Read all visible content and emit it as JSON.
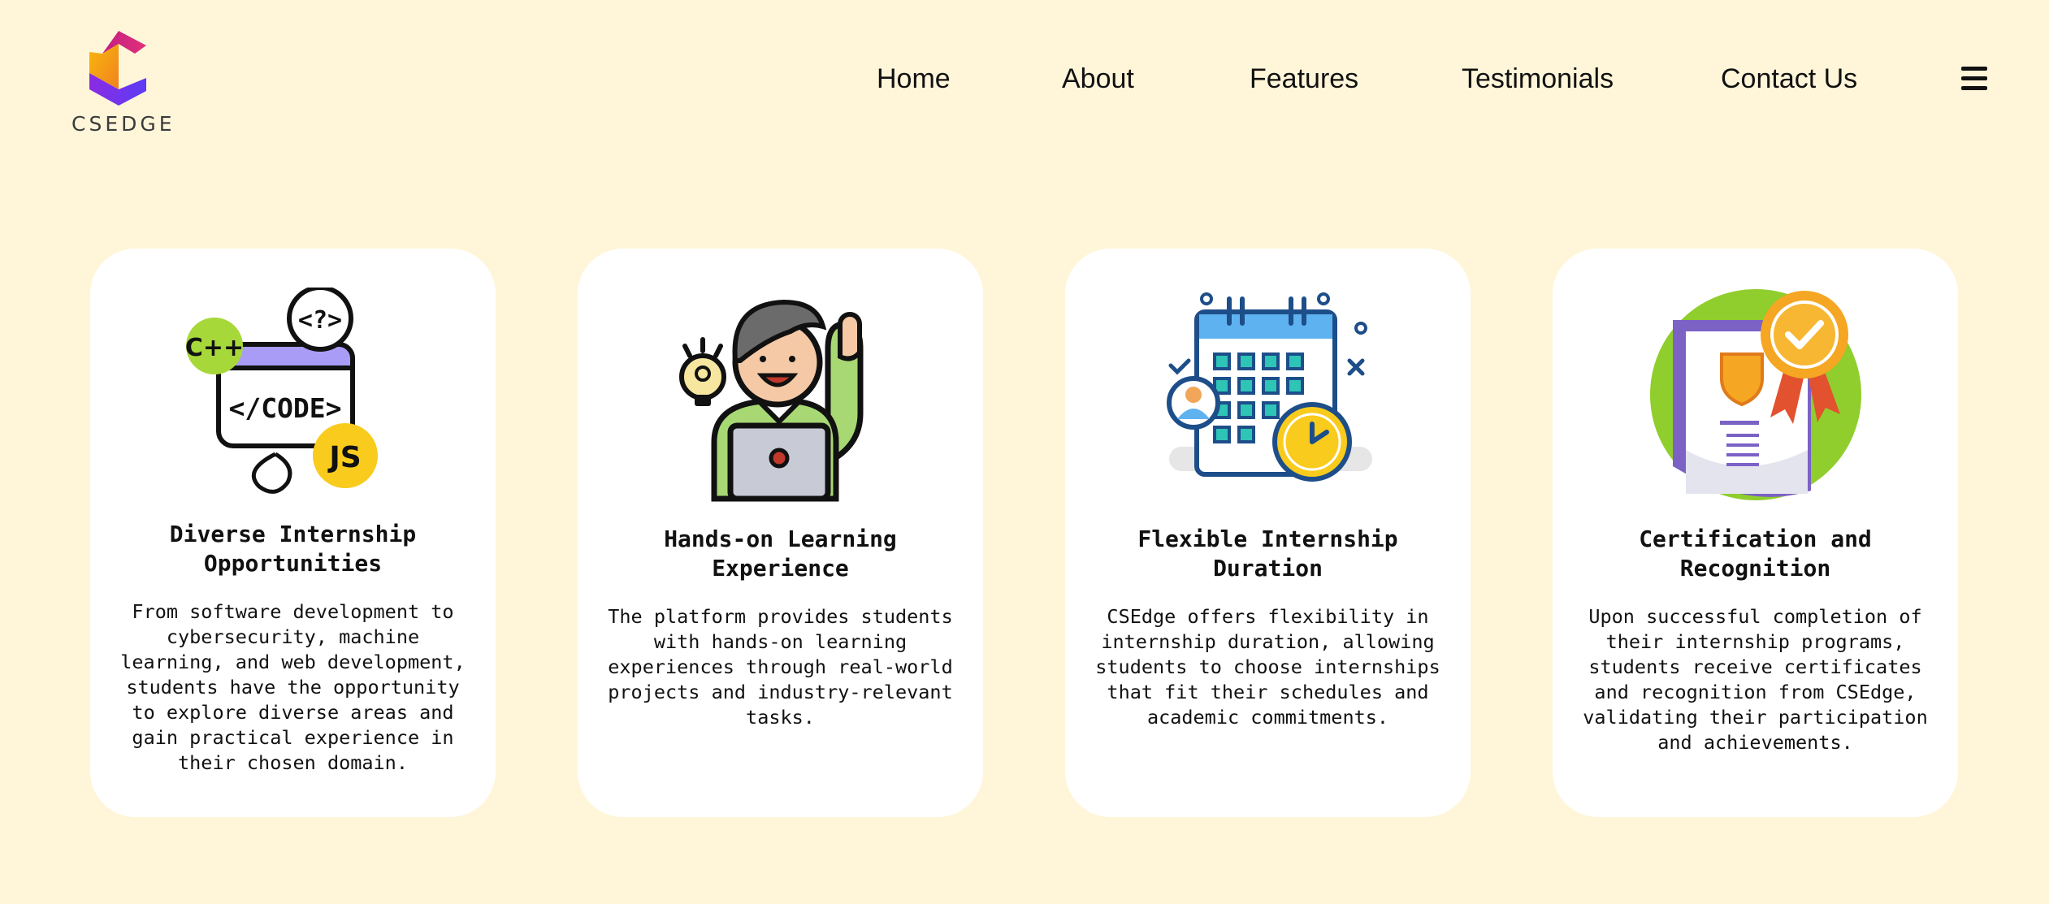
{
  "brand": {
    "name": "CSEDGE",
    "logo_icon": "csedge-c-logo",
    "colors": {
      "magenta": "#d6247a",
      "orange": "#f59e0b",
      "purple": "#7c3aed"
    }
  },
  "nav": {
    "items": [
      {
        "label": "Home"
      },
      {
        "label": "About"
      },
      {
        "label": "Features"
      },
      {
        "label": "Testimonials"
      },
      {
        "label": "Contact Us"
      }
    ],
    "menu_icon": "hamburger-menu-icon"
  },
  "features": [
    {
      "icon": "code-languages-icon",
      "title": "Diverse Internship Opportunities",
      "description": "From software development to cybersecurity, machine learning, and web development, students have the opportunity to explore diverse areas and gain practical experience in their chosen domain."
    },
    {
      "icon": "learner-laptop-icon",
      "title": "Hands-on Learning Experience",
      "description": "The platform provides students with hands-on learning experiences through real-world projects and industry-relevant tasks."
    },
    {
      "icon": "calendar-clock-icon",
      "title": "Flexible Internship Duration",
      "description": "CSEdge offers flexibility in internship duration, allowing students to choose internships that fit their schedules and academic commitments."
    },
    {
      "icon": "certificate-badge-icon",
      "title": "Certification and Recognition",
      "description": "Upon successful completion of their internship programs, students receive certificates and recognition from CSEdge, validating their participation and achievements."
    }
  ],
  "icon_labels": {
    "cpp": "C++",
    "code": "</CODE>",
    "query": "<?>",
    "js": "JS"
  }
}
